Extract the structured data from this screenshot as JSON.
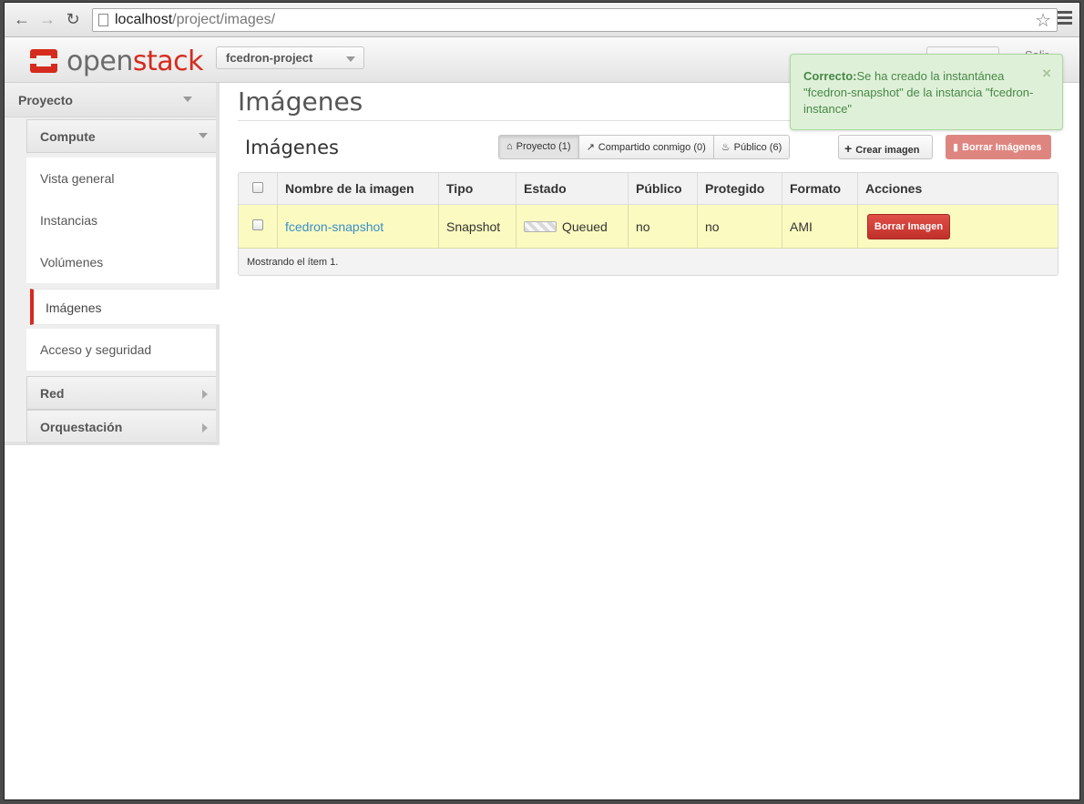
{
  "browser": {
    "url_host": "localhost",
    "url_path": "/project/images/"
  },
  "header": {
    "logo_open": "open",
    "logo_stack": "stack",
    "project": "fcedron-project",
    "logout": "Salir"
  },
  "sidebar": {
    "section": "Proyecto",
    "compute": "Compute",
    "items": [
      {
        "label": "Vista general"
      },
      {
        "label": "Instancias"
      },
      {
        "label": "Volúmenes"
      },
      {
        "label": "Imágenes"
      },
      {
        "label": "Acceso y seguridad"
      }
    ],
    "network": "Red",
    "orchestration": "Orquestación"
  },
  "page": {
    "title": "Imágenes",
    "section_title": "Imágenes"
  },
  "filters": [
    {
      "label": "Proyecto (1)",
      "icon": "home-icon"
    },
    {
      "label": "Compartido conmigo (0)",
      "icon": "share-icon"
    },
    {
      "label": "Público (6)",
      "icon": "fire-icon"
    }
  ],
  "actions": {
    "create": "Crear imagen",
    "delete_all": "Borrar Imágenes"
  },
  "table": {
    "columns": [
      "Nombre de la imagen",
      "Tipo",
      "Estado",
      "Público",
      "Protegido",
      "Formato",
      "Acciones"
    ],
    "rows": [
      {
        "name": "fcedron-snapshot",
        "type": "Snapshot",
        "status": "Queued",
        "public": "no",
        "protected": "no",
        "format": "AMI",
        "action": "Borrar Imagen"
      }
    ],
    "footer": "Mostrando el ítem 1."
  },
  "alert": {
    "label": "Correcto:",
    "message": "Se ha creado la instantánea \"fcedron-snapshot\" de la instancia \"fcedron-instance\"",
    "close": "×"
  },
  "colors": {
    "brand_red": "#d52b1e",
    "link_blue": "#3a8ec9",
    "success_bg": "#dff0d8",
    "success_text": "#468847",
    "row_highlight": "#fbfbc1"
  }
}
